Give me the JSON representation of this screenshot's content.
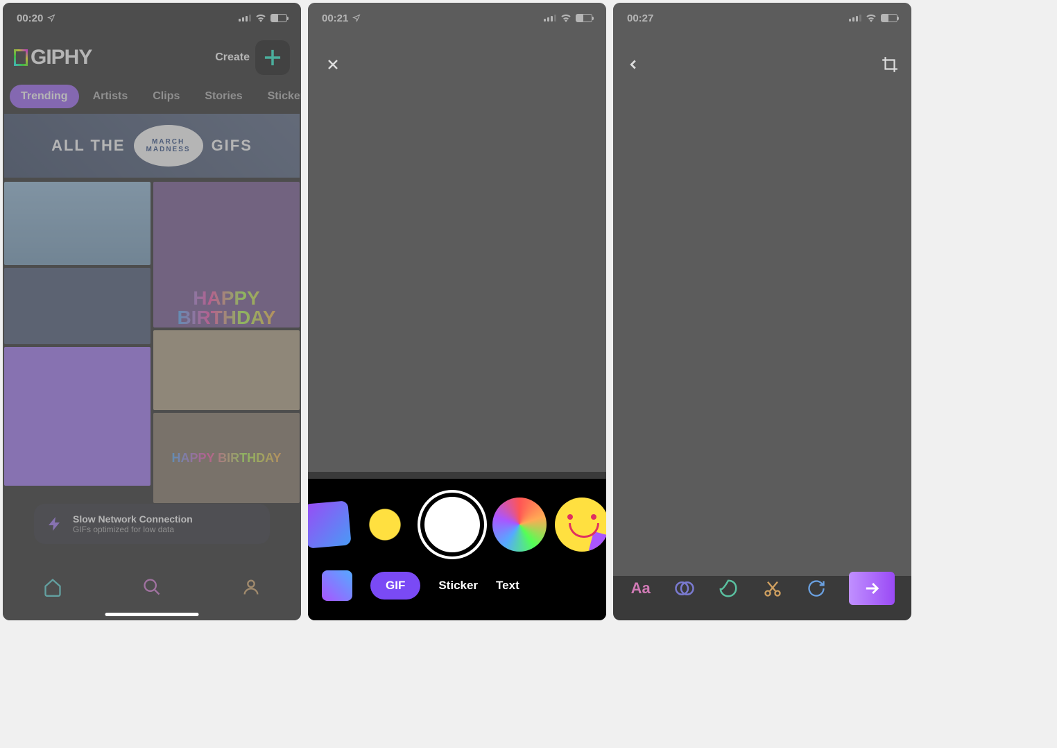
{
  "screen1": {
    "status": {
      "time": "00:20"
    },
    "logo": "GIPHY",
    "create_label": "Create",
    "tabs": [
      "Trending",
      "Artists",
      "Clips",
      "Stories",
      "Stickers"
    ],
    "banner": {
      "left": "ALL THE",
      "logo_top": "MARCH",
      "logo_bottom": "MADNESS",
      "right": "GIFS"
    },
    "tiles": {
      "happy": "HAPPY",
      "birthday_top": "BIRTHDAY",
      "birthday_bottom": "HAPPY BIRTHDAY"
    },
    "toast": {
      "title": "Slow Network Connection",
      "subtitle": "GIFs optimized for low data"
    }
  },
  "screen2": {
    "status": {
      "time": "00:21"
    },
    "modes": {
      "gif": "GIF",
      "sticker": "Sticker",
      "text": "Text"
    }
  },
  "screen3": {
    "status": {
      "time": "00:27"
    },
    "tools": {
      "aa": "Aa"
    }
  }
}
